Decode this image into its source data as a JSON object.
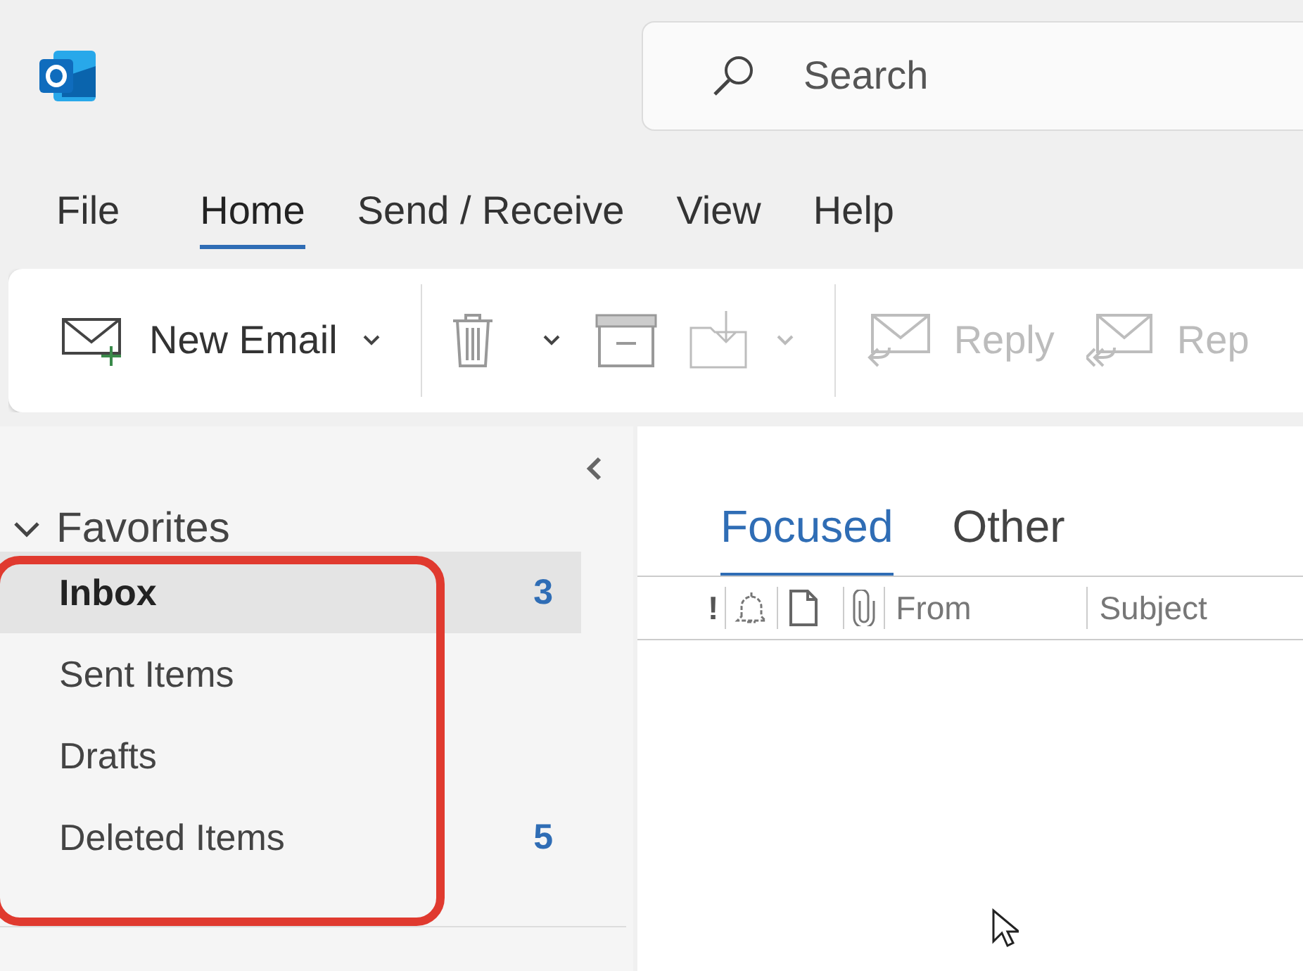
{
  "search": {
    "placeholder": "Search"
  },
  "menu_tabs": [
    {
      "label": "File",
      "selected": false
    },
    {
      "label": "Home",
      "selected": true
    },
    {
      "label": "Send / Receive",
      "selected": false
    },
    {
      "label": "View",
      "selected": false
    },
    {
      "label": "Help",
      "selected": false
    }
  ],
  "ribbon": [
    {
      "kind": "new-email",
      "label": "New Email",
      "dropdown": true,
      "disabled": false
    },
    {
      "kind": "separator"
    },
    {
      "kind": "delete",
      "dropdown": true,
      "disabled": false
    },
    {
      "kind": "archive",
      "dropdown": false,
      "disabled": false
    },
    {
      "kind": "move",
      "dropdown": true,
      "disabled": true
    },
    {
      "kind": "separator"
    },
    {
      "kind": "reply",
      "label": "Reply",
      "dropdown": false,
      "disabled": true
    },
    {
      "kind": "reply-all",
      "label": "Rep",
      "dropdown": false,
      "disabled": true
    }
  ],
  "folder_pane": {
    "favorites": {
      "label": "Favorites",
      "expanded": true
    },
    "folders": [
      {
        "label": "Inbox",
        "count": "3",
        "selected": true,
        "unread": true
      },
      {
        "label": "Sent Items",
        "selected": false,
        "unread": false
      },
      {
        "label": "Drafts",
        "selected": false,
        "unread": false
      },
      {
        "label": "Deleted Items",
        "count": "5",
        "selected": false,
        "unread": false
      }
    ]
  },
  "mail_list": {
    "view_tabs": [
      {
        "label": "Focused",
        "selected": true
      },
      {
        "label": "Other",
        "selected": false
      }
    ],
    "columns": [
      {
        "kind": "importance",
        "label": "!"
      },
      {
        "kind": "reminder"
      },
      {
        "kind": "item-type"
      },
      {
        "kind": "attachment"
      },
      {
        "kind": "text",
        "label": "From"
      },
      {
        "kind": "text",
        "label": "Subject"
      }
    ]
  }
}
